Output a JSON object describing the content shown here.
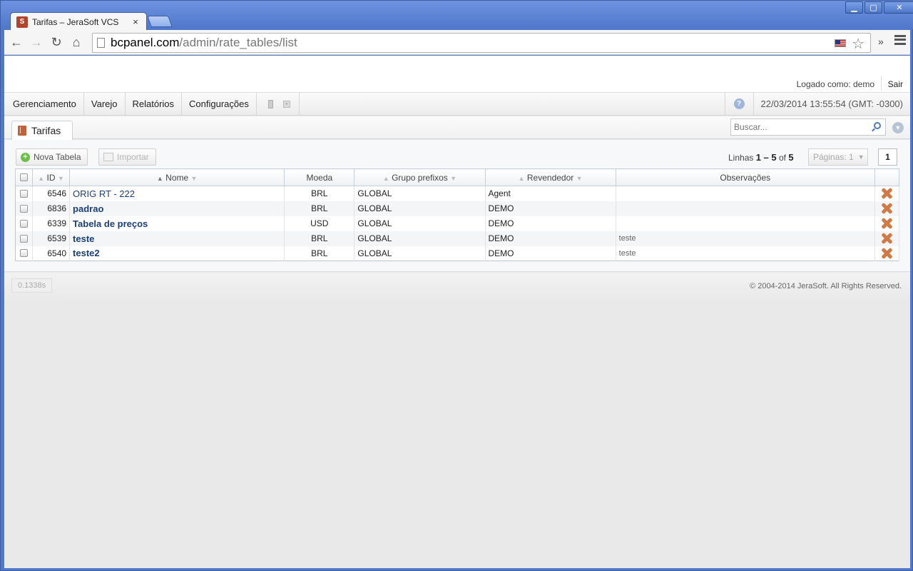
{
  "browser": {
    "tab_title": "Tarifas – JeraSoft VCS",
    "tab_close": "×",
    "url_host": "bcpanel.com",
    "url_path": "/admin/rate_tables/list",
    "more": "»"
  },
  "window_controls": {
    "minimize": "▁",
    "maximize": "▢",
    "close": "✕"
  },
  "header": {
    "login_info": "Logado como: demo",
    "logout": "Sair"
  },
  "menu": {
    "items": [
      "Gerenciamento",
      "Varejo",
      "Relatórios",
      "Configurações"
    ],
    "help": "?",
    "datetime": "22/03/2014 13:55:54 (GMT: -0300)"
  },
  "page_tab": {
    "label": "Tarifas"
  },
  "search": {
    "placeholder": "Buscar..."
  },
  "toolbar": {
    "new_label": "Nova Tabela",
    "import_label": "Importar",
    "rows_prefix": "Linhas",
    "rows_range": "1 – 5",
    "rows_of": "of",
    "rows_total": "5",
    "pages_label": "Páginas: 1",
    "current_page": "1"
  },
  "table": {
    "columns": [
      "ID",
      "Nome",
      "Moeda",
      "Grupo prefixos",
      "Revendedor",
      "Observações"
    ],
    "rows": [
      {
        "id": "6546",
        "name": "ORIG RT - 222",
        "currency": "BRL",
        "group": "GLOBAL",
        "reseller": "Agent",
        "notes": "",
        "bold": false
      },
      {
        "id": "6836",
        "name": "padrao",
        "currency": "BRL",
        "group": "GLOBAL",
        "reseller": "DEMO",
        "notes": "",
        "bold": true
      },
      {
        "id": "6339",
        "name": "Tabela de preços",
        "currency": "USD",
        "group": "GLOBAL",
        "reseller": "DEMO",
        "notes": "",
        "bold": true
      },
      {
        "id": "6539",
        "name": "teste",
        "currency": "BRL",
        "group": "GLOBAL",
        "reseller": "DEMO",
        "notes": "teste",
        "bold": true
      },
      {
        "id": "6540",
        "name": "teste2",
        "currency": "BRL",
        "group": "GLOBAL",
        "reseller": "DEMO",
        "notes": "teste",
        "bold": true
      }
    ]
  },
  "footer": {
    "timing": "0.1338s",
    "copyright": "© 2004-2014 JeraSoft. All Rights Reserved."
  },
  "colors": {
    "chrome_frame": "#5279c9",
    "link": "#1b3f78",
    "delete": "#d07a45",
    "add": "#6cbf4b"
  }
}
